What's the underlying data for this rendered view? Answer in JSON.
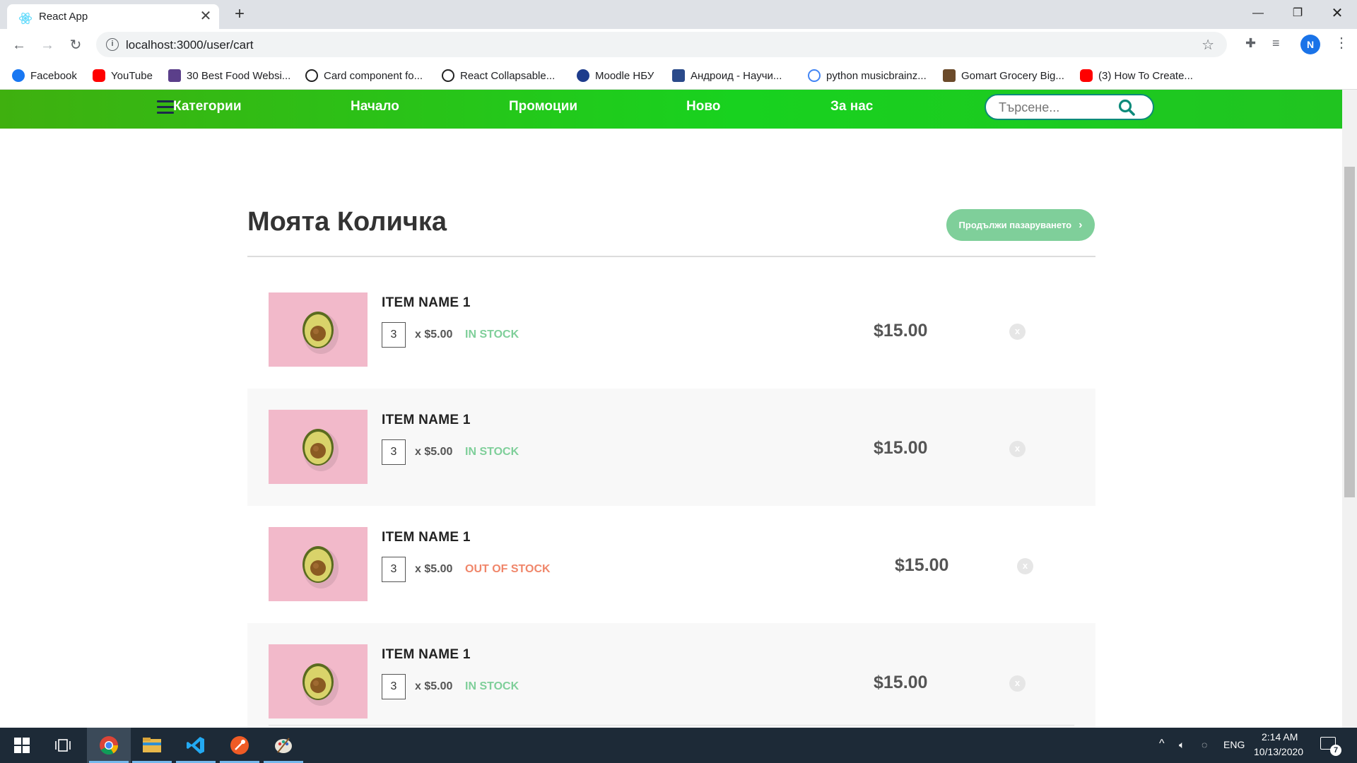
{
  "browser": {
    "tab_title": "React App",
    "url": "localhost:3000/user/cart",
    "profile_initial": "N",
    "bookmarks": [
      "Facebook",
      "YouTube",
      "30 Best Food Websi...",
      "Card component fo...",
      "React Collapsable...",
      "Moodle НБУ",
      "Андроид - Научи...",
      "python musicbrainz...",
      "Gomart Grocery Big...",
      "(3) How To Create..."
    ]
  },
  "nav": {
    "categories": "Категории",
    "home": "Начало",
    "promotions": "Промоции",
    "new": "Ново",
    "about": "За нас",
    "search_placeholder": "Търсене..."
  },
  "cart": {
    "title": "Моята Количка",
    "continue_label": "Продължи пазаруването",
    "items": [
      {
        "name": "ITEM NAME 1",
        "qty": "3",
        "unit_price": "x $5.00",
        "stock": "IN STOCK",
        "in_stock": true,
        "total": "$15.00"
      },
      {
        "name": "ITEM NAME 1",
        "qty": "3",
        "unit_price": "x $5.00",
        "stock": "IN STOCK",
        "in_stock": true,
        "total": "$15.00"
      },
      {
        "name": "ITEM NAME 1",
        "qty": "3",
        "unit_price": "x $5.00",
        "stock": "OUT OF STOCK",
        "in_stock": false,
        "total": "$15.00"
      },
      {
        "name": "ITEM NAME 1",
        "qty": "3",
        "unit_price": "x $5.00",
        "stock": "IN STOCK",
        "in_stock": true,
        "total": "$15.00"
      }
    ],
    "remove_label": "x"
  },
  "taskbar": {
    "language": "ENG",
    "time": "2:14 AM",
    "date": "10/13/2020",
    "notifications": "7"
  },
  "colors": {
    "nav_green": "#18d21f",
    "in_stock": "#7fcf9a",
    "out_of_stock": "#f0866a",
    "continue_button": "#7fcf9a"
  }
}
